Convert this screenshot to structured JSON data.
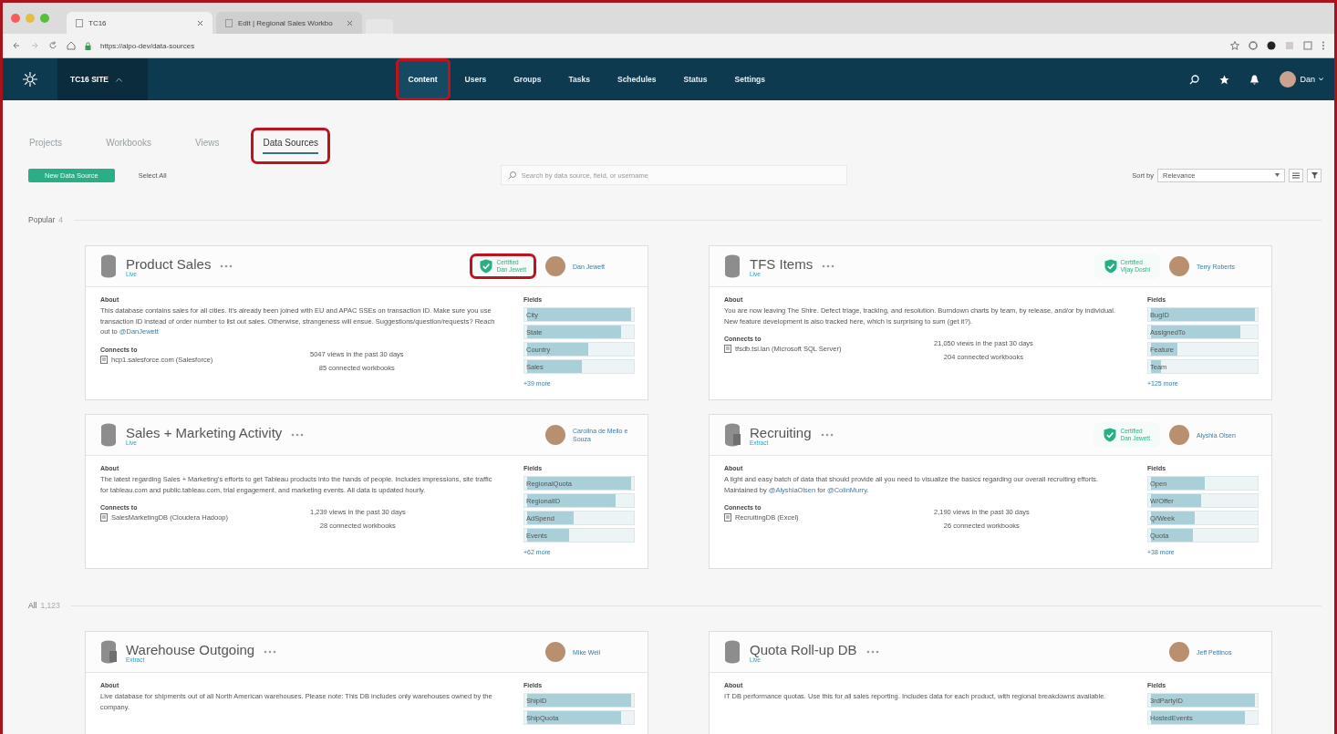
{
  "browser": {
    "tabs": [
      {
        "title": "TC16",
        "selected": true
      },
      {
        "title": "Edit | Regional Sales Workbo",
        "selected": false
      }
    ],
    "url": "https://alpo-dev/data-sources"
  },
  "nav": {
    "site": "TC16 SITE",
    "items": [
      {
        "label": "Content",
        "selected": true,
        "highlighted": true
      },
      {
        "label": "Users",
        "selected": false,
        "highlighted": false
      },
      {
        "label": "Groups",
        "selected": false,
        "highlighted": false
      },
      {
        "label": "Tasks",
        "selected": false,
        "highlighted": false
      },
      {
        "label": "Schedules",
        "selected": false,
        "highlighted": false
      },
      {
        "label": "Status",
        "selected": false,
        "highlighted": false
      },
      {
        "label": "Settings",
        "selected": false,
        "highlighted": false
      }
    ],
    "user": "Dan"
  },
  "tabs": [
    {
      "label": "Projects",
      "selected": false,
      "highlighted": false
    },
    {
      "label": "Workbooks",
      "selected": false,
      "highlighted": false
    },
    {
      "label": "Views",
      "selected": false,
      "highlighted": false
    },
    {
      "label": "Data Sources",
      "selected": true,
      "highlighted": true
    }
  ],
  "toolbar": {
    "new_button": "New Data Source",
    "select_all": "Select All",
    "search": {
      "placeholder": "Search by data source, field, or username"
    },
    "sort_label": "Sort by",
    "sort_value": "Relevance"
  },
  "sections": [
    {
      "title": "Popular",
      "count": "4",
      "cards": [
        {
          "kind": "live",
          "name": "Product Sales",
          "type": "Live",
          "certified": {
            "label": "Certified",
            "by": "Dan Jewett",
            "highlighted": true
          },
          "owner": "Dan Jewett",
          "about_label": "About",
          "about": [
            {
              "kind": "text",
              "text": "This database contains sales for all cities.  It's already been joined with EU and APAC SSEs on transaction ID.  Make sure you use transaction ID instead of order number to list out sales. Otherwise, strangeness will ensue. Suggestions/question/requests? Reach out to "
            },
            {
              "kind": "mention",
              "text": "@DanJewett"
            }
          ],
          "connects_label": "Connects to",
          "connection": "hcp1.salesforce.com (Salesforce)",
          "views": "5047 views in the past 30 days",
          "workbooks": "85 connected workbooks",
          "fields_label": "Fields",
          "fields": [
            {
              "name": "City",
              "level": 1
            },
            {
              "name": "State",
              "level": 0.9
            },
            {
              "name": "Country",
              "level": 0.59
            },
            {
              "name": "Sales",
              "level": 0.53
            }
          ],
          "more": "+39 more"
        },
        {
          "kind": "live",
          "name": "TFS Items",
          "type": "Live",
          "certified": {
            "label": "Certified",
            "by": "Vijay Doshi",
            "highlighted": false
          },
          "owner": "Terry Roberts",
          "about_label": "About",
          "about": [
            {
              "kind": "text",
              "text": "You are now leaving The Shire. Defect triage, tracking, and resolution. Burndown charts by team, by release, and/or by individual. New feature development is also tracked here, which is surprising to sum (get it?)."
            }
          ],
          "connects_label": "Connects to",
          "connection": "tfsdb.tsi.lan (Microsoft SQL Server)",
          "views": "21,050 views in the past 30 days",
          "workbooks": "204 connected workbooks",
          "fields_label": "Fields",
          "fields": [
            {
              "name": "BugID",
              "level": 1
            },
            {
              "name": "AssignedTo",
              "level": 0.86
            },
            {
              "name": "Feature",
              "level": 0.25
            },
            {
              "name": "Team",
              "level": 0.1
            }
          ],
          "more": "+125 more"
        },
        {
          "kind": "live",
          "name": "Sales + Marketing Activity",
          "type": "Live",
          "owner": "Carolina de Mello e Souza",
          "about_label": "About",
          "about": [
            {
              "kind": "text",
              "text": "The latest regarding Sales + Marketing's efforts to get Tableau products into the hands of people. Includes impressions, site traffic for tableau.com and public.tableau.com, trial engagement, and marketing events. All data is updated hourly."
            }
          ],
          "connects_label": "Connects to",
          "connection": "SalesMarketingDB (Cloudera Hadoop)",
          "views": "1,239 views in the past 30 days",
          "workbooks": "28 connected workbooks",
          "fields_label": "Fields",
          "fields": [
            {
              "name": "RegionalQuota",
              "level": 1
            },
            {
              "name": "RegionalID",
              "level": 0.85
            },
            {
              "name": "AdSpend",
              "level": 0.45
            },
            {
              "name": "Events",
              "level": 0.4
            }
          ],
          "more": "+62 more"
        },
        {
          "kind": "extract",
          "name": "Recruiting",
          "type": "Extract",
          "certified": {
            "label": "Certified",
            "by": "Dan Jewett",
            "highlighted": false
          },
          "owner": "Alyshia Olsen",
          "about_label": "About",
          "about": [
            {
              "kind": "text",
              "text": "A light and easy batch of data that should provide all you need to visualize the basics regarding our overall recruiting efforts. Maintained by "
            },
            {
              "kind": "mention",
              "text": "@AlyshiaOlsen"
            },
            {
              "kind": "text",
              "text": " for "
            },
            {
              "kind": "mention",
              "text": "@ColinMurry"
            },
            {
              "kind": "text",
              "text": "."
            }
          ],
          "connects_label": "Connects to",
          "connection": "RecruitingDB (Excel)",
          "views": "2,190 views in the past 30 days",
          "workbooks": "26 connected workbooks",
          "fields_label": "Fields",
          "fields": [
            {
              "name": "Open",
              "level": 0.52
            },
            {
              "name": "W/Offer",
              "level": 0.48
            },
            {
              "name": "Q/Week",
              "level": 0.42
            },
            {
              "name": "Quota",
              "level": 0.4
            }
          ],
          "more": "+38 more"
        }
      ]
    },
    {
      "title": "All",
      "count": "1,123",
      "cards": [
        {
          "kind": "extract",
          "name": "Warehouse Outgoing",
          "type": "Extract",
          "owner": "Mike Weil",
          "about_label": "About",
          "about": [
            {
              "kind": "text",
              "text": "Live database for shipments out of all North American warehouses. Please note: This DB includes only warehouses owned by the company."
            }
          ],
          "fields_label": "Fields",
          "fields": [
            {
              "name": "ShipID",
              "level": 1
            },
            {
              "name": "ShipQuota",
              "level": 0.9
            }
          ]
        },
        {
          "kind": "live",
          "name": "Quota Roll-up DB",
          "type": "Live",
          "owner": "Jeff Pettinos",
          "about_label": "About",
          "about": [
            {
              "kind": "text",
              "text": "IT DB performance quotas. Use this for all sales reporting.  Includes data for each product, with regional breakdowns available."
            }
          ],
          "fields_label": "Fields",
          "fields": [
            {
              "name": "3rdPartyID",
              "level": 1
            },
            {
              "name": "HostedEvents",
              "level": 0.9
            }
          ]
        }
      ]
    }
  ]
}
